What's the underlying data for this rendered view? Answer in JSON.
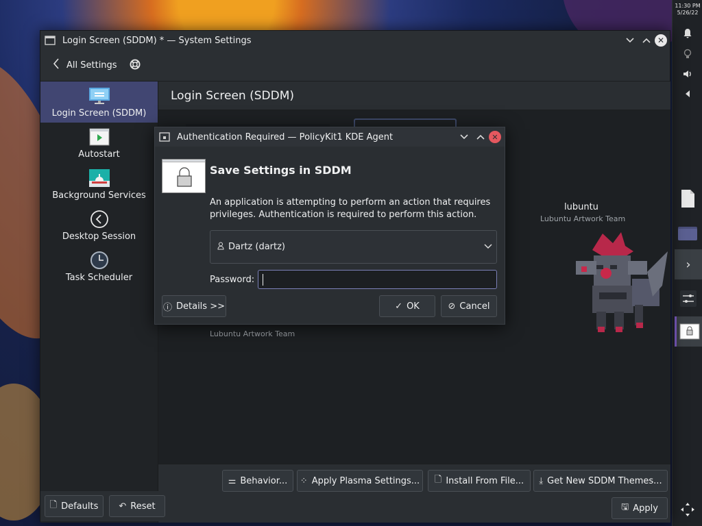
{
  "window": {
    "title": "Login Screen (SDDM) * — System Settings",
    "toolbar_label": "All Settings"
  },
  "sidebar": {
    "items": [
      {
        "label": "Login Screen (SDDM)"
      },
      {
        "label": "Autostart"
      },
      {
        "label": "Background Services"
      },
      {
        "label": "Desktop Session"
      },
      {
        "label": "Task Scheduler"
      }
    ]
  },
  "content": {
    "heading": "Login Screen (SDDM)",
    "themes": [
      {
        "name": "lubuntu",
        "author": "Lubuntu Artwork Team"
      },
      {
        "name": "",
        "author": "Lubuntu Artwork Team"
      }
    ],
    "buttons": {
      "behavior": "Behavior...",
      "apply_plasma": "Apply Plasma Settings...",
      "install_file": "Install From File...",
      "get_new": "Get New SDDM Themes..."
    },
    "footer": {
      "defaults": "Defaults",
      "reset": "Reset",
      "apply": "Apply"
    }
  },
  "dialog": {
    "title": "Authentication Required — PolicyKit1 KDE Agent",
    "heading": "Save Settings in SDDM",
    "message": "An application is attempting to perform an action that requires privileges. Authentication is required to perform this action.",
    "user_selected": "Dartz (dartz)",
    "password_label": "Password:",
    "password_value": "",
    "details_label": "Details >>",
    "ok_label": "OK",
    "cancel_label": "Cancel"
  },
  "panel": {
    "time": "11:30 PM",
    "date": "5/26/22"
  },
  "colors": {
    "accent": "#7b80b8",
    "selection": "#414672",
    "close_red": "#e5585f"
  }
}
